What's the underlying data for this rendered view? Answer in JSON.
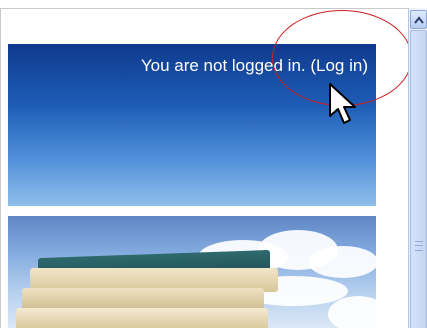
{
  "header": {
    "login_prefix": "You are not logged in. ",
    "login_link": "(Log in)"
  },
  "annotation": {
    "circle_color": "#cc1f1f"
  },
  "icons": {
    "cursor": "mouse-pointer-icon",
    "scroll_up": "chevron-up-icon"
  },
  "colors": {
    "banner_top": "#0f3a8d",
    "banner_bottom": "#8fbfeb",
    "link_text": "#ffffff"
  }
}
